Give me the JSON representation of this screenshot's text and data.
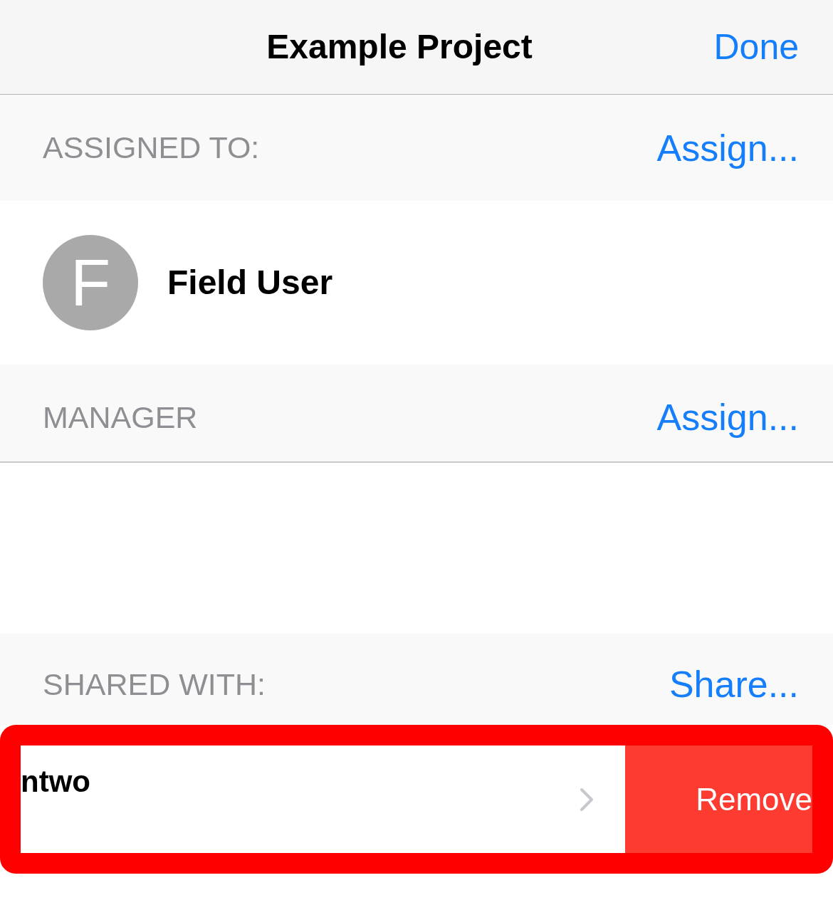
{
  "nav_bar": {
    "title": "Example Project",
    "done_button": "Done"
  },
  "assigned_to": {
    "header": "ASSIGNED TO:",
    "action": "Assign...",
    "users": [
      {
        "initial": "F",
        "name": "Field User"
      }
    ]
  },
  "manager": {
    "header": "MANAGER",
    "action": "Assign..."
  },
  "shared_with": {
    "header": "SHARED WITH:",
    "action": "Share...",
    "rows": [
      {
        "name": "ntwo",
        "swiped": true,
        "highlighted": true,
        "action": "Remove"
      }
    ]
  }
}
